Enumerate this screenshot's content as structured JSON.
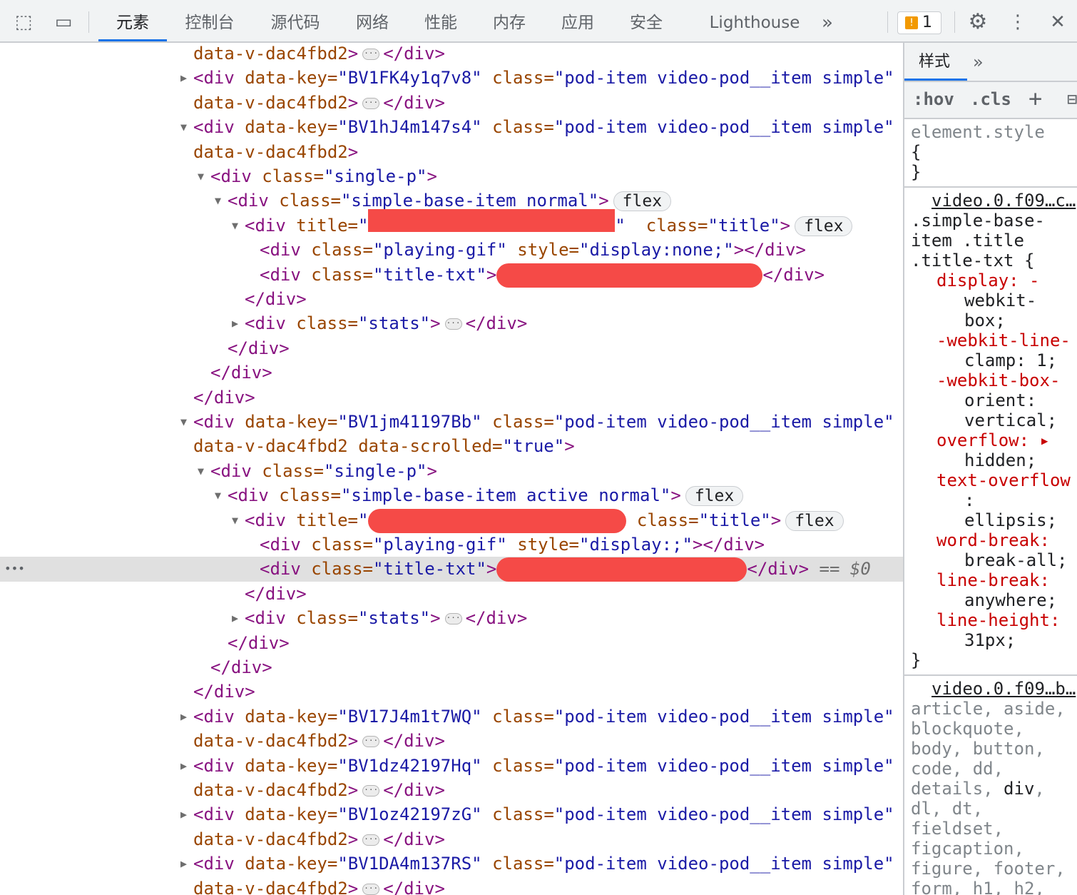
{
  "toolbar": {
    "inspect_icon": "inspect-element-icon",
    "device_icon": "device-toolbar-icon",
    "tabs": [
      "元素",
      "控制台",
      "源代码",
      "网络",
      "性能",
      "内存",
      "应用",
      "安全",
      "Lighthouse"
    ],
    "more": "»",
    "issues_count": "1",
    "issues_icon": "!"
  },
  "elements": {
    "selected_row": 21,
    "rows": [
      {
        "d": 0,
        "ar": "",
        "tk": [
          [
            "n",
            "data-v-dac4fbd2"
          ],
          [
            "c"
          ],
          [
            "e"
          ],
          [
            "x",
            "div"
          ]
        ]
      },
      {
        "d": 0,
        "ar": "right",
        "tk": [
          [
            "o",
            "div"
          ],
          [
            "a",
            "data-key",
            "BV1FK4y1q7v8"
          ],
          [
            "a",
            "class",
            "pod-item video-pod__item simple"
          ]
        ]
      },
      {
        "d": 0,
        "ar": "",
        "tk": [
          [
            "n",
            "data-v-dac4fbd2"
          ],
          [
            "c"
          ],
          [
            "e"
          ],
          [
            "x",
            "div"
          ]
        ]
      },
      {
        "d": 0,
        "ar": "down",
        "tk": [
          [
            "o",
            "div"
          ],
          [
            "a",
            "data-key",
            "BV1hJ4m147s4"
          ],
          [
            "a",
            "class",
            "pod-item video-pod__item simple"
          ]
        ]
      },
      {
        "d": 0,
        "ar": "",
        "tk": [
          [
            "n",
            "data-v-dac4fbd2"
          ],
          [
            "c"
          ]
        ]
      },
      {
        "d": 1,
        "ar": "down",
        "tk": [
          [
            "o",
            "div"
          ],
          [
            "a",
            "class",
            "single-p"
          ],
          [
            "c"
          ]
        ]
      },
      {
        "d": 2,
        "ar": "down",
        "tk": [
          [
            "o",
            "div"
          ],
          [
            "a",
            "class",
            "simple-base-item normal"
          ],
          [
            "c"
          ],
          [
            "b",
            "flex"
          ]
        ]
      },
      {
        "d": 3,
        "ar": "down",
        "tk": [
          [
            "o",
            "div"
          ],
          [
            "ap",
            "title"
          ],
          [
            "r",
            "r1"
          ],
          [
            "q"
          ],
          [
            "a",
            "class",
            "title"
          ],
          [
            "c"
          ],
          [
            "b",
            "flex"
          ]
        ]
      },
      {
        "d": 4,
        "ar": "",
        "tk": [
          [
            "o",
            "div"
          ],
          [
            "a",
            "class",
            "playing-gif"
          ],
          [
            "a",
            "style",
            "display:none;"
          ],
          [
            "c"
          ],
          [
            "x",
            "div"
          ]
        ]
      },
      {
        "d": 4,
        "ar": "",
        "tk": [
          [
            "o",
            "div"
          ],
          [
            "a",
            "class",
            "title-txt"
          ],
          [
            "c"
          ],
          [
            "r",
            "r2"
          ],
          [
            "x",
            "div"
          ]
        ]
      },
      {
        "d": 3,
        "ar": "",
        "tk": [
          [
            "x",
            "div"
          ]
        ]
      },
      {
        "d": 3,
        "ar": "right",
        "tk": [
          [
            "o",
            "div"
          ],
          [
            "a",
            "class",
            "stats"
          ],
          [
            "c"
          ],
          [
            "e"
          ],
          [
            "x",
            "div"
          ]
        ]
      },
      {
        "d": 2,
        "ar": "",
        "tk": [
          [
            "x",
            "div"
          ]
        ]
      },
      {
        "d": 1,
        "ar": "",
        "tk": [
          [
            "x",
            "div"
          ]
        ]
      },
      {
        "d": 0,
        "ar": "",
        "tk": [
          [
            "x",
            "div"
          ]
        ]
      },
      {
        "d": 0,
        "ar": "down",
        "tk": [
          [
            "o",
            "div"
          ],
          [
            "a",
            "data-key",
            "BV1jm41197Bb"
          ],
          [
            "a",
            "class",
            "pod-item video-pod__item simple"
          ]
        ]
      },
      {
        "d": 0,
        "ar": "",
        "tk": [
          [
            "n",
            "data-v-dac4fbd2"
          ],
          [
            "a",
            "data-scrolled",
            "true"
          ],
          [
            "c"
          ]
        ]
      },
      {
        "d": 1,
        "ar": "down",
        "tk": [
          [
            "o",
            "div"
          ],
          [
            "a",
            "class",
            "single-p"
          ],
          [
            "c"
          ]
        ]
      },
      {
        "d": 2,
        "ar": "down",
        "tk": [
          [
            "o",
            "div"
          ],
          [
            "a",
            "class",
            "simple-base-item active normal"
          ],
          [
            "c"
          ],
          [
            "b",
            "flex"
          ]
        ]
      },
      {
        "d": 3,
        "ar": "down",
        "tk": [
          [
            "o",
            "div"
          ],
          [
            "ap",
            "title"
          ],
          [
            "r",
            "r3"
          ],
          [
            "a",
            "class",
            "title"
          ],
          [
            "c"
          ],
          [
            "b",
            "flex"
          ]
        ]
      },
      {
        "d": 4,
        "ar": "",
        "tk": [
          [
            "o",
            "div"
          ],
          [
            "a",
            "class",
            "playing-gif"
          ],
          [
            "a",
            "style",
            "display:;"
          ],
          [
            "c"
          ],
          [
            "x",
            "div"
          ]
        ]
      },
      {
        "d": 4,
        "ar": "",
        "tk": [
          [
            "o",
            "div"
          ],
          [
            "a",
            "class",
            "title-txt"
          ],
          [
            "c"
          ],
          [
            "r",
            "r4"
          ],
          [
            "x",
            "div"
          ],
          [
            "s",
            " == $0"
          ]
        ]
      },
      {
        "d": 3,
        "ar": "",
        "tk": [
          [
            "x",
            "div"
          ]
        ]
      },
      {
        "d": 3,
        "ar": "right",
        "tk": [
          [
            "o",
            "div"
          ],
          [
            "a",
            "class",
            "stats"
          ],
          [
            "c"
          ],
          [
            "e"
          ],
          [
            "x",
            "div"
          ]
        ]
      },
      {
        "d": 2,
        "ar": "",
        "tk": [
          [
            "x",
            "div"
          ]
        ]
      },
      {
        "d": 1,
        "ar": "",
        "tk": [
          [
            "x",
            "div"
          ]
        ]
      },
      {
        "d": 0,
        "ar": "",
        "tk": [
          [
            "x",
            "div"
          ]
        ]
      },
      {
        "d": 0,
        "ar": "right",
        "tk": [
          [
            "o",
            "div"
          ],
          [
            "a",
            "data-key",
            "BV17J4m1t7WQ"
          ],
          [
            "a",
            "class",
            "pod-item video-pod__item simple"
          ]
        ]
      },
      {
        "d": 0,
        "ar": "",
        "tk": [
          [
            "n",
            "data-v-dac4fbd2"
          ],
          [
            "c"
          ],
          [
            "e"
          ],
          [
            "x",
            "div"
          ]
        ]
      },
      {
        "d": 0,
        "ar": "right",
        "tk": [
          [
            "o",
            "div"
          ],
          [
            "a",
            "data-key",
            "BV1dz42197Hq"
          ],
          [
            "a",
            "class",
            "pod-item video-pod__item simple"
          ]
        ]
      },
      {
        "d": 0,
        "ar": "",
        "tk": [
          [
            "n",
            "data-v-dac4fbd2"
          ],
          [
            "c"
          ],
          [
            "e"
          ],
          [
            "x",
            "div"
          ]
        ]
      },
      {
        "d": 0,
        "ar": "right",
        "tk": [
          [
            "o",
            "div"
          ],
          [
            "a",
            "data-key",
            "BV1oz42197zG"
          ],
          [
            "a",
            "class",
            "pod-item video-pod__item simple"
          ]
        ]
      },
      {
        "d": 0,
        "ar": "",
        "tk": [
          [
            "n",
            "data-v-dac4fbd2"
          ],
          [
            "c"
          ],
          [
            "e"
          ],
          [
            "x",
            "div"
          ]
        ]
      },
      {
        "d": 0,
        "ar": "right",
        "tk": [
          [
            "o",
            "div"
          ],
          [
            "a",
            "data-key",
            "BV1DA4m137RS"
          ],
          [
            "a",
            "class",
            "pod-item video-pod__item simple"
          ]
        ]
      },
      {
        "d": 0,
        "ar": "",
        "tk": [
          [
            "n",
            "data-v-dac4fbd2"
          ],
          [
            "c"
          ],
          [
            "e"
          ],
          [
            "x",
            "div"
          ]
        ]
      }
    ]
  },
  "styles": {
    "tab": "样式",
    "more": "»",
    "hov": ":hov",
    "cls": ".cls",
    "add": "+",
    "element_style": [
      {
        "k": "gray",
        "t": "element.style"
      },
      {
        "k": "",
        "t": "{"
      },
      {
        "k": "",
        "t": "}"
      }
    ],
    "rule1": [
      {
        "k": "src",
        "t": "video.0.f09…c…"
      },
      {
        "k": "",
        "t": ".simple-base-"
      },
      {
        "k": "",
        "t": "item .title"
      },
      {
        "k": "",
        "t": ".title-txt {"
      },
      {
        "k": "prop",
        "t": "display: -"
      },
      {
        "k": "val",
        "t": "webkit-"
      },
      {
        "k": "val",
        "t": "box;"
      },
      {
        "k": "prop",
        "t": "-webkit-line-"
      },
      {
        "k": "val",
        "t": "clamp: 1;"
      },
      {
        "k": "prop",
        "t": "-webkit-box-"
      },
      {
        "k": "val",
        "t": "orient:"
      },
      {
        "k": "val",
        "t": "vertical;"
      },
      {
        "k": "prop",
        "t": "overflow: ▸"
      },
      {
        "k": "val",
        "t": "hidden;"
      },
      {
        "k": "prop",
        "t": "text-overflow"
      },
      {
        "k": "val",
        "t": ":"
      },
      {
        "k": "val",
        "t": "ellipsis;"
      },
      {
        "k": "prop",
        "t": "word-break:"
      },
      {
        "k": "val",
        "t": "break-all;"
      },
      {
        "k": "prop",
        "t": "line-break:"
      },
      {
        "k": "val",
        "t": "anywhere;"
      },
      {
        "k": "prop",
        "t": "line-height:"
      },
      {
        "k": "val",
        "t": "31px;"
      },
      {
        "k": "",
        "t": "}"
      }
    ],
    "rule2": [
      {
        "k": "src",
        "t": "video.0.f09…b…"
      },
      {
        "k": "dim",
        "t": "article, aside,"
      },
      {
        "k": "dim",
        "t": "blockquote,"
      },
      {
        "k": "dim",
        "t": "body, button,"
      },
      {
        "k": "dim",
        "t": "code, dd,"
      },
      {
        "k": "dim",
        "t": "details, div,"
      },
      {
        "k": "dim",
        "t": "dl, dt,"
      },
      {
        "k": "dim",
        "t": "fieldset,"
      },
      {
        "k": "dim",
        "t": "figcaption,"
      },
      {
        "k": "dim",
        "t": "figure, footer,"
      },
      {
        "k": "dim",
        "t": "form, h1, h2,"
      }
    ]
  }
}
